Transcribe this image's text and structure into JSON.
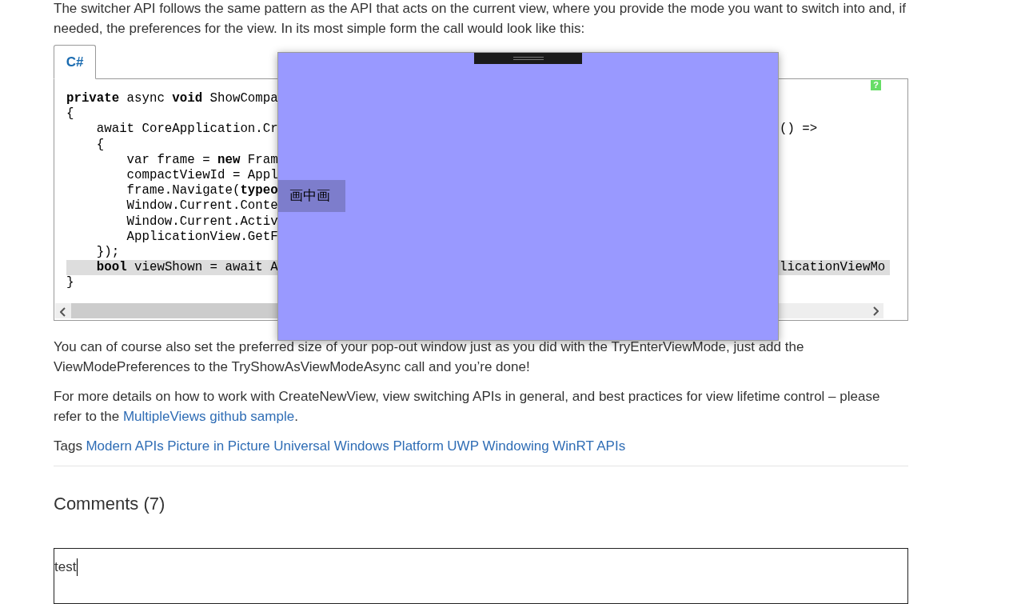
{
  "intro": "The switcher API follows the same pattern as the API that acts on the current view, where you provide the mode you want to switch into and, if needed, the preferences for the view. In its most simple form the call would look like this:",
  "code_tabs": [
    {
      "label": "C#",
      "selected": true
    }
  ],
  "help_badge": "?",
  "code_lines": [
    {
      "left": "**private** async **void** ShowCompa",
      "highlighted": false
    },
    {
      "left": "{",
      "highlighted": false
    },
    {
      "left": "    await CoreApplication.Cr",
      "right": "() =>",
      "highlighted": false
    },
    {
      "left": "    {",
      "highlighted": false
    },
    {
      "left": "        var frame = **new** Fram",
      "highlighted": false
    },
    {
      "left": "        compactViewId = Appl",
      "highlighted": false
    },
    {
      "left": "        frame.Navigate(**typeo**",
      "highlighted": false
    },
    {
      "left": "        Window.Current.Conte",
      "highlighted": false
    },
    {
      "left": "        Window.Current.Activ",
      "highlighted": false
    },
    {
      "left": "        ApplicationView.GetF",
      "highlighted": false
    },
    {
      "left": "    });",
      "highlighted": false
    },
    {
      "left": "    **bool** viewShown = await A",
      "right": "licationViewMo",
      "highlighted": true
    },
    {
      "left": "}",
      "highlighted": false
    }
  ],
  "pip_window": {
    "label": "画中画"
  },
  "paragraphs": [
    {
      "text": "You can of course also set the preferred size of your pop-out window just as you did with the TryEnterViewMode, just add the ViewModePreferences to the TryShowAsViewModeAsync call and you’re done!"
    },
    {
      "text": "For more details on how to work with CreateNewView, view switching APIs in general, and best practices for view lifetime control – please refer to the ",
      "link": "MultipleViews github sample",
      "after": "."
    }
  ],
  "tags": {
    "label": "Tags",
    "items": [
      "Modern APIs",
      "Picture in Picture",
      "Universal Windows Platform",
      "UWP",
      "Windowing",
      "WinRT APIs"
    ]
  },
  "comments": {
    "heading": "Comments (7)",
    "input_value": "test"
  }
}
